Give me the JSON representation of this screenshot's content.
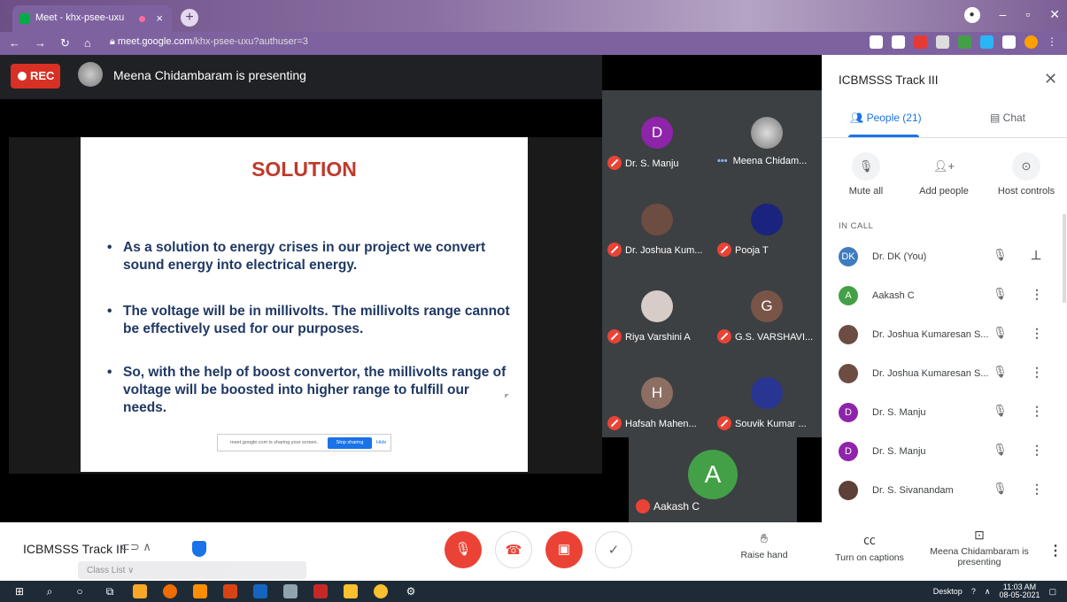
{
  "browser": {
    "tab_title": "Meet - khx-psee-uxu",
    "url_host": "meet.google.com",
    "url_path": "/khx-psee-uxu?authuser=3"
  },
  "meet": {
    "rec_label": "REC",
    "presenting_text": "Meena Chidambaram is presenting"
  },
  "slide": {
    "title": "SOLUTION",
    "bullets": [
      "As a solution to energy crises in our project we convert  sound energy into electrical energy.",
      "The voltage will be in millivolts. The millivolts range cannot be effectively used for our purposes.",
      "So, with the help of  boost convertor, the millivolts range of voltage will be boosted into higher range to fulfill our needs."
    ],
    "share_text": "meet.google.com is sharing your screen.",
    "stop_sharing": "Stop sharing",
    "hide": "Hide"
  },
  "tiles": [
    {
      "name": "Dr. S. Manju",
      "initial": "D",
      "color": "#8e24aa",
      "muted": true
    },
    {
      "name": "Meena Chidam...",
      "initial": "",
      "color": "#9e9e9e",
      "muted": false
    },
    {
      "name": "Dr. Joshua Kum...",
      "initial": "",
      "color": "#6d4c41",
      "muted": true
    },
    {
      "name": "Pooja T",
      "initial": "",
      "color": "#1a237e",
      "muted": true
    },
    {
      "name": "Riya Varshini A",
      "initial": "",
      "color": "#d7ccc8",
      "muted": true
    },
    {
      "name": "G.S. VARSHAVI...",
      "initial": "G",
      "color": "#795548",
      "muted": true
    },
    {
      "name": "Hafsah Mahen...",
      "initial": "H",
      "color": "#8d6e63",
      "muted": true
    },
    {
      "name": "Souvik Kumar ...",
      "initial": "",
      "color": "#283593",
      "muted": true
    }
  ],
  "big_tile": {
    "name": "Aakash C",
    "initial": "A"
  },
  "panel": {
    "title": "ICBMSSS Track III",
    "people_tab": "People (21)",
    "chat_tab": "Chat",
    "mute_all": "Mute all",
    "add_people": "Add people",
    "host_controls": "Host controls",
    "in_call": "IN CALL",
    "people": [
      {
        "name": "Dr. DK (You)",
        "initial": "DK",
        "color": "#3f7cbf"
      },
      {
        "name": "Aakash C",
        "initial": "A",
        "color": "#43a047"
      },
      {
        "name": "Dr. Joshua Kumaresan S...",
        "initial": "",
        "color": "#6d4c41"
      },
      {
        "name": "Dr. Joshua Kumaresan S...",
        "initial": "",
        "color": "#6d4c41"
      },
      {
        "name": "Dr. S. Manju",
        "initial": "D",
        "color": "#8e24aa"
      },
      {
        "name": "Dr. S. Manju",
        "initial": "D",
        "color": "#8e24aa"
      },
      {
        "name": "Dr. S. Sivanandam",
        "initial": "",
        "color": "#5d4037"
      }
    ]
  },
  "bottom": {
    "meeting_title": "ICBMSSS Track III",
    "class_list": "Class List",
    "raise_hand": "Raise hand",
    "captions": "Turn on captions",
    "presenting": "Meena Chidambaram is presenting"
  },
  "taskbar": {
    "desktop": "Desktop",
    "time": "11:03 AM",
    "date": "08-05-2021"
  }
}
